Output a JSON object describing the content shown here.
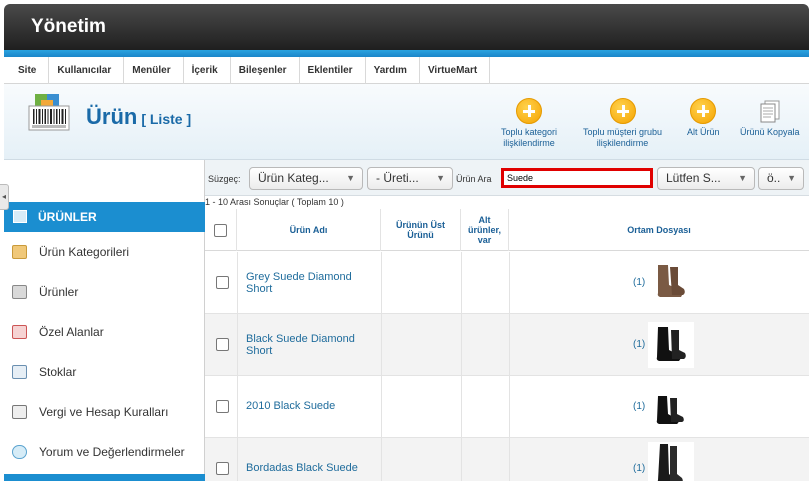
{
  "header": {
    "title": "Yönetim"
  },
  "menu": [
    "Site",
    "Kullanıcılar",
    "Menüler",
    "İçerik",
    "Bileşenler",
    "Eklentiler",
    "Yardım",
    "VirtueMart"
  ],
  "toolbar": {
    "title": "Ürün",
    "subtitle": "[ Liste ]",
    "buttons": [
      {
        "label_line1": "Toplu kategori",
        "label_line2": "ilişkilendirme"
      },
      {
        "label_line1": "Toplu müşteri grubu",
        "label_line2": "ilişkilendirme"
      },
      {
        "label_line1": "Alt Ürün",
        "label_line2": ""
      },
      {
        "label_line1": "Ürünü Kopyala",
        "label_line2": ""
      }
    ]
  },
  "sidebar": {
    "header": "ÜRÜNLER",
    "items": [
      {
        "label": "Ürün Kategorileri",
        "icon": "folder-icon"
      },
      {
        "label": "Ürünler",
        "icon": "camera-icon"
      },
      {
        "label": "Özel Alanlar",
        "icon": "fields-icon"
      },
      {
        "label": "Stoklar",
        "icon": "chart-icon"
      },
      {
        "label": "Vergi ve Hesap Kuralları",
        "icon": "calculator-icon"
      },
      {
        "label": "Yorum ve Değerlendirmeler",
        "icon": "comment-icon"
      }
    ]
  },
  "filter": {
    "label": "Süzgeç:",
    "category_select": "Ürün Kateg...",
    "manufacturer_select": "- Üreti...",
    "search_label": "Ürün Ara",
    "search_value": "Suede",
    "select_3": "Lütfen S...",
    "select_4": "ö.."
  },
  "results_text": "1 - 10 Arası Sonuçlar ( Toplam 10 )",
  "table": {
    "columns": [
      "Ürün Adı",
      "Ürünün Üst Ürünü",
      "Alt ürünler, var",
      "Ortam Dosyası"
    ],
    "rows": [
      {
        "name": "Grey Suede Diamond Short",
        "media_count": "(1)",
        "boot_color": "#7a5a44"
      },
      {
        "name": "Black Suede Diamond Short",
        "media_count": "(1)",
        "boot_color": "#111111"
      },
      {
        "name": "2010 Black Suede",
        "media_count": "(1)",
        "boot_color": "#111111"
      },
      {
        "name": "Bordadas Black Suede",
        "media_count": "(1)",
        "boot_color": "#1a1a1a"
      }
    ]
  }
}
